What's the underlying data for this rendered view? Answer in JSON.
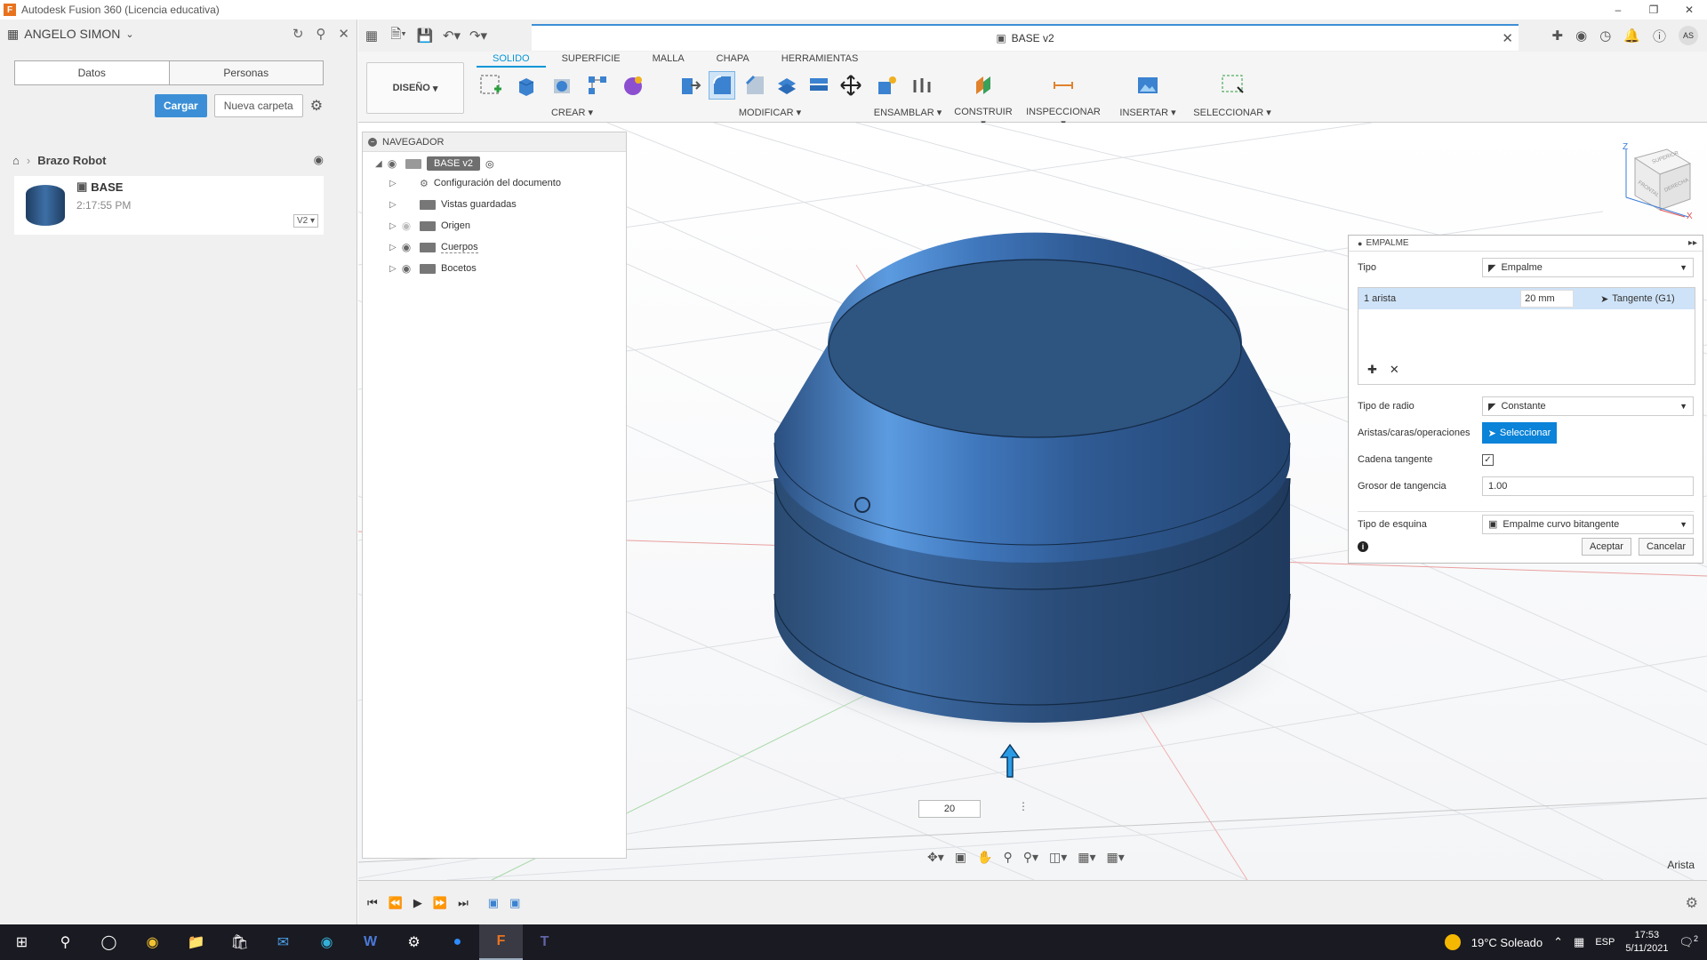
{
  "window": {
    "title": "Autodesk Fusion 360 (Licencia educativa)"
  },
  "data_panel": {
    "user": "ANGELO SIMON",
    "tabs": [
      "Datos",
      "Personas"
    ],
    "upload_label": "Cargar",
    "new_folder_label": "Nueva carpeta",
    "breadcrumb": "Brazo Robot",
    "item": {
      "name": "BASE",
      "time": "2:17:55 PM",
      "version": "V2"
    }
  },
  "document": {
    "tab_title": "BASE v2"
  },
  "user_initials": "AS",
  "ribbon": {
    "tabs": [
      "SOLIDO",
      "SUPERFICIE",
      "MALLA",
      "CHAPA",
      "HERRAMIENTAS"
    ],
    "active_tab": "SOLIDO",
    "design_label": "DISEÑO",
    "groups": [
      "CREAR",
      "MODIFICAR",
      "ENSAMBLAR",
      "CONSTRUIR",
      "INSPECCIONAR",
      "INSERTAR",
      "SELECCIONAR"
    ]
  },
  "navigator": {
    "title": "NAVEGADOR",
    "root": "BASE v2",
    "items": [
      "Configuración del documento",
      "Vistas guardadas",
      "Origen",
      "Cuerpos",
      "Bocetos"
    ]
  },
  "fillet": {
    "title": "EMPALME",
    "tipo_label": "Tipo",
    "tipo_value": "Empalme",
    "edge_label": "1 arista",
    "radius_value": "20 mm",
    "continuity": "Tangente (G1)",
    "radius_type_label": "Tipo de radio",
    "radius_type_value": "Constante",
    "selection_label": "Aristas/caras/operaciones",
    "select_button": "Seleccionar",
    "tangent_chain_label": "Cadena tangente",
    "tangent_chain_checked": true,
    "tangency_weight_label": "Grosor de tangencia",
    "tangency_weight_value": "1.00",
    "corner_type_label": "Tipo de esquina",
    "corner_type_value": "Empalme curvo bitangente",
    "ok_label": "Aceptar",
    "cancel_label": "Cancelar"
  },
  "viewport": {
    "dimension_value": "20",
    "status": "Arista",
    "viewcube_labels": [
      "SUPERIOR",
      "FRONTAL",
      "DERECHA"
    ],
    "axis_z": "Z",
    "axis_x": "X"
  },
  "taskbar": {
    "weather": "19°C  Soleado",
    "language": "ESP",
    "time": "17:53",
    "date": "5/11/2021",
    "notifications": "2"
  },
  "colors": {
    "accent": "#0696d7",
    "body": "#2d4f78",
    "select": "#0a83d8"
  }
}
